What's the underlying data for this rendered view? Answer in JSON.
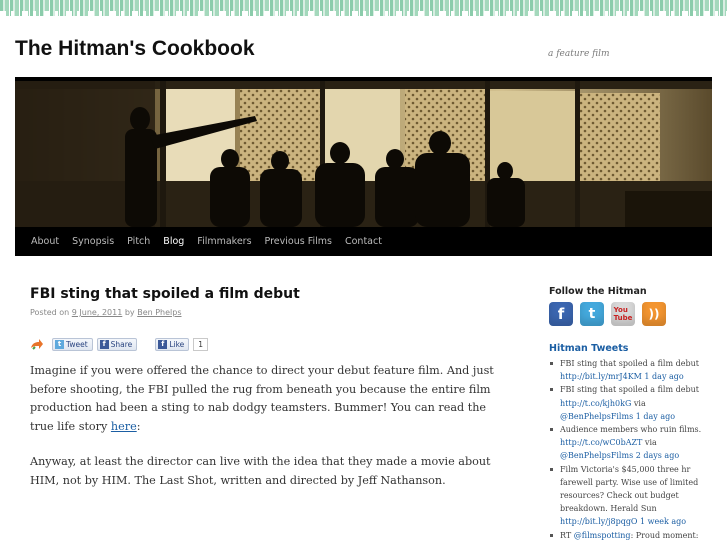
{
  "site": {
    "title": "The Hitman's Cookbook",
    "description": "a feature film"
  },
  "nav": {
    "items": [
      {
        "label": "About"
      },
      {
        "label": "Synopsis"
      },
      {
        "label": "Pitch"
      },
      {
        "label": "Blog"
      },
      {
        "label": "Filmmakers"
      },
      {
        "label": "Previous Films"
      },
      {
        "label": "Contact"
      }
    ],
    "current": "Blog"
  },
  "post": {
    "title": "FBI sting that spoiled a film debut",
    "meta_prefix": "Posted on",
    "date": "9 June, 2011",
    "meta_by": "by",
    "author": "Ben Phelps",
    "share": {
      "tweet_label": "Tweet",
      "share_label": "Share",
      "like_label": "Like",
      "like_count": "1"
    },
    "paragraph1_text": "Imagine if you were offered the chance to direct your debut feature film. And just before shooting, the FBI pulled the rug from beneath you because the entire film production had been a sting to nab dodgy teamsters. Bummer! You can read the true life story ",
    "paragraph1_link": "here",
    "paragraph1_end": ":",
    "paragraph2": "Anyway, at least the director can live with the idea that they made a movie about HIM, not by HIM.  The Last Shot, written and directed by Jeff Nathanson."
  },
  "sidebar": {
    "follow_title": "Follow the Hitman",
    "social": [
      "facebook-icon",
      "twitter-icon",
      "youtube-icon",
      "rss-icon"
    ],
    "tweets_title": "Hitman Tweets",
    "tweets": [
      {
        "text": "FBI sting that spoiled a film debut ",
        "link": "http://bit.ly/mrJ4KM",
        "via": "",
        "mention": "",
        "time": " 1 day ago"
      },
      {
        "text": "FBI sting that spoiled a film debut ",
        "link": "http://t.co/kjh0kG",
        "via": " via ",
        "mention": "@BenPhelpsFilms",
        "time": " 1 day ago"
      },
      {
        "text": "Audience members who ruin films. ",
        "link": "http://t.co/wC0bAZT",
        "via": " via ",
        "mention": "@BenPhelpsFilms",
        "time": " 2 days ago"
      },
      {
        "text": "Film Victoria's $45,000 three hr farewell party. Wise use of limited resources? Check out budget breakdown. Herald Sun ",
        "link": "http://bit.ly/j8pqgO",
        "via": "",
        "mention": "",
        "time": " 1 week ago"
      },
      {
        "text": "RT ",
        "link": "",
        "via": "",
        "mention": "@filmspotting",
        "time": ": Proud moment:"
      }
    ]
  },
  "colors": {
    "link": "#1b5ea3",
    "nav_background": "#000000",
    "header_sepia": "#6b5a36"
  }
}
